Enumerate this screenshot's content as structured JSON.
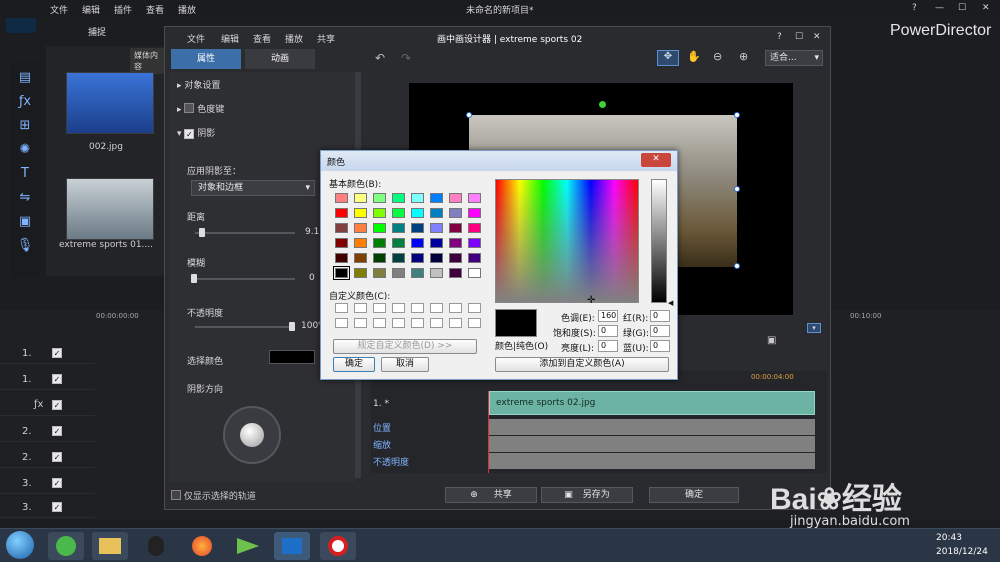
{
  "app": {
    "menu": [
      "文件",
      "编辑",
      "插件",
      "查看",
      "播放"
    ],
    "title": "未命名的新项目*",
    "brand": "PowerDirector",
    "window_controls": [
      "?",
      "—",
      "☐",
      "✕"
    ],
    "capture_tab": "捕捉",
    "media_button": "媒体内容"
  },
  "media": [
    {
      "file": "002.jpg"
    },
    {
      "file": "extreme sports 01...."
    }
  ],
  "timeline": {
    "ruler": [
      "00:00:00:00",
      "00:10:00"
    ],
    "tracks": [
      "1.",
      "1.",
      "",
      "2.",
      "2.",
      "3.",
      "3."
    ]
  },
  "pip": {
    "title": "画中画设计器 | extreme sports 02",
    "menu": [
      "文件",
      "编辑",
      "查看",
      "播放",
      "共享"
    ],
    "tabs": [
      "属性",
      "动画"
    ],
    "sections": [
      "对象设置",
      "色度键",
      "阴影"
    ],
    "apply_shadow_label": "应用阴影至：",
    "apply_shadow_value": "对象和边框",
    "distance_label": "距离",
    "distance_value": "9.1",
    "blur_label": "模糊",
    "blur_value": "0",
    "opacity_label": "不透明度",
    "opacity_value": "100%",
    "select_color_label": "选择颜色",
    "shadow_direction_label": "阴影方向",
    "only_selected_label": "仅显示选择的轨道",
    "zoom_select": "适合...",
    "timecode": "00:00:04:00",
    "clip_track_label": "1. *",
    "clip_name": "extreme sports 02.jpg",
    "keyframe_rows": [
      "位置",
      "缩放",
      "不透明度"
    ],
    "share_btn": "共享",
    "save_as_btn": "另存为",
    "ok_btn": "确定"
  },
  "color_dialog": {
    "title": "颜色",
    "basic_colors_label": "基本颜色(B):",
    "custom_colors_label": "自定义颜色(C):",
    "define_custom_btn": "规定自定义颜色(D) >>",
    "ok": "确定",
    "cancel": "取消",
    "color_solid_label": "颜色|纯色(O)",
    "add_custom_btn": "添加到自定义颜色(A)",
    "hue_label": "色调(E):",
    "hue": "160",
    "sat_label": "饱和度(S):",
    "sat": "0",
    "lum_label": "亮度(L):",
    "lum": "0",
    "red_label": "红(R):",
    "red": "0",
    "green_label": "绿(G):",
    "green": "0",
    "blue_label": "蓝(U):",
    "blue": "0",
    "basic_colors": [
      "#ff8080",
      "#ffff80",
      "#80ff80",
      "#00ff80",
      "#80ffff",
      "#0080ff",
      "#ff80c0",
      "#ff80ff",
      "#ff0000",
      "#ffff00",
      "#80ff00",
      "#00ff40",
      "#00ffff",
      "#0080c0",
      "#8080c0",
      "#ff00ff",
      "#804040",
      "#ff8040",
      "#00ff00",
      "#008080",
      "#004080",
      "#8080ff",
      "#800040",
      "#ff0080",
      "#800000",
      "#ff8000",
      "#008000",
      "#008040",
      "#0000ff",
      "#0000a0",
      "#800080",
      "#8000ff",
      "#400000",
      "#804000",
      "#004000",
      "#004040",
      "#000080",
      "#000040",
      "#400040",
      "#400080",
      "#000000",
      "#808000",
      "#808040",
      "#808080",
      "#408080",
      "#c0c0c0",
      "#400040",
      "#ffffff"
    ]
  },
  "taskbar": {
    "time": "20:43",
    "date": "2018/12/24"
  },
  "watermark": {
    "brand": "Bai",
    "cn": "经验",
    "url": "jingyan.baidu.com"
  }
}
